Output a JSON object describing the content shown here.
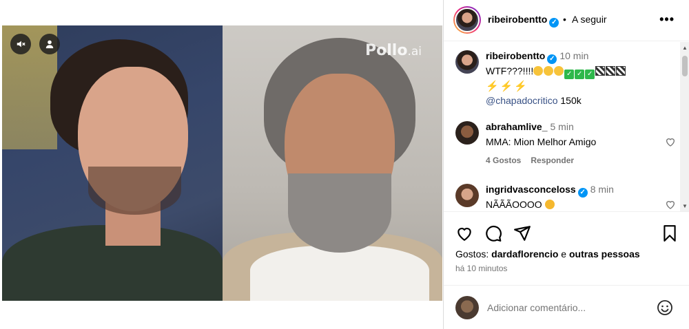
{
  "post": {
    "watermark_main": "Pollo",
    "watermark_suffix": ".ai"
  },
  "header": {
    "username": "ribeirobentto",
    "separator": "•",
    "follow_label": "A seguir",
    "more_label": "•••"
  },
  "comments": [
    {
      "username": "ribeirobentto",
      "time": "10 min",
      "text": "WTF???!!!!",
      "emojis": [
        "confused-face",
        "confused-face",
        "confused-face",
        "check-mark",
        "check-mark",
        "check-mark",
        "clapper-board",
        "clapper-board",
        "clapper-board",
        "high-voltage",
        "high-voltage",
        "high-voltage"
      ],
      "mention": "@chapadocritico",
      "mention_suffix": "150k"
    },
    {
      "username": "abrahamlive_",
      "time": "5 min",
      "text": "MMA: Mion Melhor Amigo",
      "likes": "4 Gostos",
      "reply_label": "Responder"
    },
    {
      "username": "ingridvasconceloss",
      "time": "8 min",
      "text": "NÃÃÃOOOO",
      "emoji": "tired-face"
    }
  ],
  "likes_line": {
    "prefix": "Gostos:",
    "user": "dardaflorencio",
    "middle": "e",
    "suffix": "outras pessoas"
  },
  "time_ago": "há 10 minutos",
  "add_comment": {
    "placeholder": "Adicionar comentário..."
  },
  "colors": {
    "verified": "#0095f6",
    "mention": "#385185",
    "muted_text": "#737373"
  }
}
